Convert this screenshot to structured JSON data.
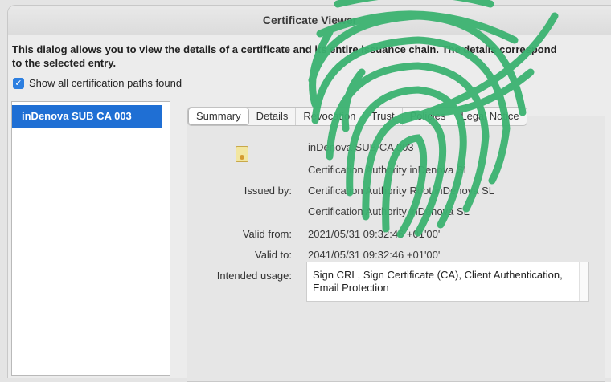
{
  "window": {
    "title": "Certificate Viewer"
  },
  "intro": {
    "text": "This dialog allows you to view the details of a certificate and its entire issuance chain. The details correspond to the selected entry."
  },
  "show_all_paths": {
    "label": "Show all certification paths found",
    "checked": true
  },
  "chain": {
    "items": [
      "inDenova SUB CA 003"
    ]
  },
  "tabs": [
    "Summary",
    "Details",
    "Revocation",
    "Trust",
    "Policies",
    "Legal Notice"
  ],
  "summary": {
    "subject_line1": "inDenova SUB CA 003",
    "subject_line2": "Certification Authority inDenova SL",
    "issued_by_label": "Issued by:",
    "issued_by_line1": "Certification Authority Root inDenova SL",
    "issued_by_line2": "Certification Authority inDenova SL",
    "valid_from_label": "Valid from:",
    "valid_from": "2021/05/31 09:32:46 +01'00'",
    "valid_to_label": "Valid to:",
    "valid_to": "2041/05/31 09:32:46 +01'00'",
    "intended_usage_label": "Intended usage:",
    "intended_usage": "Sign CRL, Sign Certificate (CA), Client Authentication, Email Protection"
  },
  "colors": {
    "accent": "#1f6fd4",
    "fingerprint": "#3cb371"
  },
  "icons": {
    "cert": "certificate-icon",
    "check": "checkmark-icon",
    "overlay": "fingerprint-icon"
  }
}
